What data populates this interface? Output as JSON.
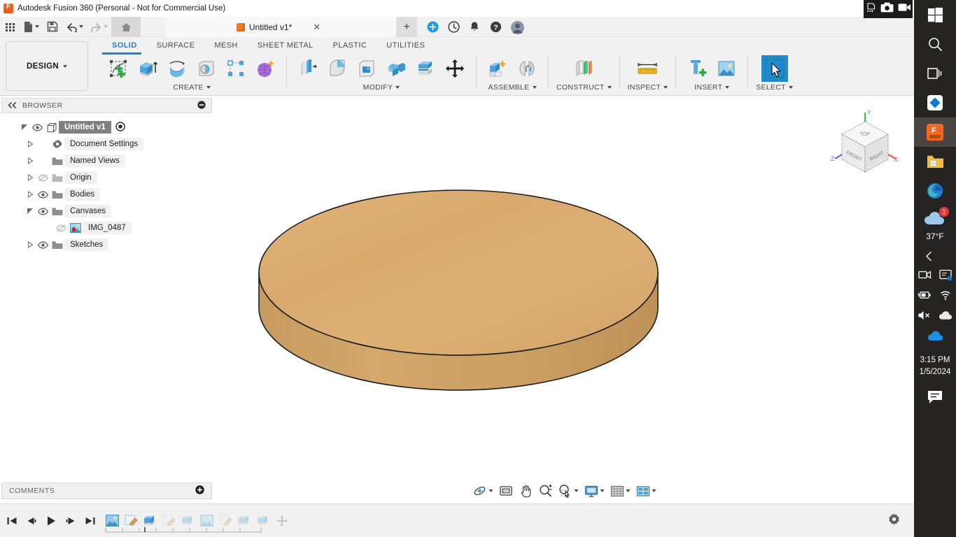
{
  "window": {
    "title": "Autodesk Fusion 360 (Personal - Not for Commercial Use)",
    "app_icon": "fusion-logo-icon",
    "controls": {
      "minimize": "—",
      "restore": "❐"
    }
  },
  "quick_access": {
    "items": [
      {
        "name": "app-grid-button",
        "icon": "grid-icon"
      },
      {
        "name": "new-file-button",
        "icon": "file-icon",
        "has_caret": true
      },
      {
        "name": "save-button",
        "icon": "floppy-disk-icon"
      },
      {
        "name": "undo-button",
        "icon": "undo-arrow-icon",
        "has_caret": true
      },
      {
        "name": "redo-button",
        "icon": "redo-arrow-icon",
        "has_caret": true
      },
      {
        "name": "home-button",
        "icon": "home-icon"
      }
    ]
  },
  "document_tab": {
    "label": "Untitled v1*",
    "icon": "orange-cube-icon",
    "close_label": "✕",
    "new_tab_label": "+",
    "icons": [
      {
        "name": "extension-manager-icon"
      },
      {
        "name": "job-status-icon"
      },
      {
        "name": "notifications-bell-icon"
      },
      {
        "name": "help-question-icon"
      },
      {
        "name": "user-avatar-icon"
      }
    ]
  },
  "ribbon": {
    "workspace_label": "DESIGN",
    "tabs": [
      {
        "label": "SOLID",
        "active": true
      },
      {
        "label": "SURFACE",
        "active": false
      },
      {
        "label": "MESH",
        "active": false
      },
      {
        "label": "SHEET METAL",
        "active": false
      },
      {
        "label": "PLASTIC",
        "active": false
      },
      {
        "label": "UTILITIES",
        "active": false
      }
    ],
    "panels": [
      {
        "label": "CREATE",
        "has_caret": true,
        "tools": [
          {
            "name": "create-sketch-tool",
            "icon": "sketch-plus-icon"
          },
          {
            "name": "extrude-tool",
            "icon": "extrude-icon"
          },
          {
            "name": "revolve-tool",
            "icon": "revolve-icon"
          },
          {
            "name": "hole-tool",
            "icon": "hole-icon"
          },
          {
            "name": "rectangular-pattern-tool",
            "icon": "pattern-icon"
          },
          {
            "name": "form-tool",
            "icon": "form-sphere-icon"
          }
        ]
      },
      {
        "label": "MODIFY",
        "has_caret": true,
        "tools": [
          {
            "name": "press-pull-tool",
            "icon": "press-pull-icon"
          },
          {
            "name": "fillet-tool",
            "icon": "fillet-icon"
          },
          {
            "name": "shell-tool",
            "icon": "shell-icon"
          },
          {
            "name": "combine-tool",
            "icon": "combine-icon"
          },
          {
            "name": "split-face-tool",
            "icon": "split-face-icon"
          },
          {
            "name": "move-copy-tool",
            "icon": "move-arrows-icon"
          }
        ]
      },
      {
        "label": "ASSEMBLE",
        "has_caret": true,
        "tools": [
          {
            "name": "new-component-tool",
            "icon": "new-component-icon"
          },
          {
            "name": "joint-tool",
            "icon": "joint-icon"
          }
        ]
      },
      {
        "label": "CONSTRUCT",
        "has_caret": true,
        "tools": [
          {
            "name": "construction-plane-tool",
            "icon": "offset-plane-icon"
          }
        ]
      },
      {
        "label": "INSPECT",
        "has_caret": true,
        "tools": [
          {
            "name": "measure-tool",
            "icon": "ruler-measure-icon"
          }
        ]
      },
      {
        "label": "INSERT",
        "has_caret": true,
        "tools": [
          {
            "name": "insert-mcmaster-tool",
            "icon": "bolt-plus-icon"
          },
          {
            "name": "insert-canvas-tool",
            "icon": "picture-icon"
          }
        ]
      },
      {
        "label": "SELECT",
        "has_caret": true,
        "tools": [
          {
            "name": "select-tool",
            "icon": "select-cursor-icon",
            "selected": true
          }
        ]
      }
    ]
  },
  "browser": {
    "header_title": "BROWSER",
    "collapse_icon": "collapse-left-icon",
    "minus_icon": "minus-circle-icon",
    "tree": [
      {
        "label": "Untitled v1",
        "indent": 0,
        "arrow": "expanded",
        "eye": "visible",
        "icon": "component-cube-icon",
        "root": true,
        "radio": true
      },
      {
        "label": "Document Settings",
        "indent": 1,
        "arrow": "collapsed",
        "eye": "none",
        "icon": "gear-icon"
      },
      {
        "label": "Named Views",
        "indent": 1,
        "arrow": "collapsed",
        "eye": "none",
        "icon": "folder-icon"
      },
      {
        "label": "Origin",
        "indent": 1,
        "arrow": "collapsed",
        "eye": "hidden",
        "icon": "folder-icon"
      },
      {
        "label": "Bodies",
        "indent": 1,
        "arrow": "collapsed",
        "eye": "visible",
        "icon": "folder-icon"
      },
      {
        "label": "Canvases",
        "indent": 1,
        "arrow": "expanded",
        "eye": "visible",
        "icon": "folder-icon"
      },
      {
        "label": "IMG_0487",
        "indent": 2,
        "arrow": "none",
        "eye": "hidden",
        "icon": "canvas-image-icon"
      },
      {
        "label": "Sketches",
        "indent": 1,
        "arrow": "collapsed",
        "eye": "visible",
        "icon": "folder-icon"
      }
    ],
    "comments": {
      "title": "COMMENTS",
      "add_icon": "plus-circle-icon"
    }
  },
  "viewcube": {
    "faces": {
      "top": "TOP",
      "front": "FRONT",
      "right": "RIGHT"
    },
    "axes": [
      {
        "label": "Y",
        "color": "#33c24d"
      },
      {
        "label": "X",
        "color": "#ef5350"
      },
      {
        "label": "Z",
        "color": "#5577dd"
      }
    ]
  },
  "model": {
    "name": "wood-cylinder-body",
    "top_color": "#dcae71",
    "side_color": "#cb9e62",
    "edge_color": "#1a1a1a"
  },
  "nav_toolbar": {
    "items": [
      {
        "name": "orbit-button",
        "icon": "orbit-icon",
        "has_caret": true
      },
      {
        "name": "look-at-button",
        "icon": "look-at-icon",
        "has_caret": false
      },
      {
        "name": "pan-button",
        "icon": "hand-pan-icon",
        "has_caret": false
      },
      {
        "name": "zoom-button",
        "icon": "zoom-plusminus-icon",
        "has_caret": false
      },
      {
        "name": "zoom-window-button",
        "icon": "zoom-window-icon",
        "has_caret": true
      },
      {
        "name": "display-settings-button",
        "icon": "monitor-icon",
        "has_caret": true
      },
      {
        "name": "grid-snaps-button",
        "icon": "grid-snap-icon",
        "has_caret": true
      },
      {
        "name": "viewports-button",
        "icon": "viewports-icon",
        "has_caret": true
      }
    ]
  },
  "timeline": {
    "playback": [
      {
        "name": "go-to-beginning-button",
        "icon": "skip-start-icon"
      },
      {
        "name": "step-back-button",
        "icon": "step-back-icon"
      },
      {
        "name": "play-button",
        "icon": "play-icon"
      },
      {
        "name": "step-forward-button",
        "icon": "step-forward-icon"
      },
      {
        "name": "go-to-end-button",
        "icon": "skip-end-icon"
      }
    ],
    "features": [
      {
        "name": "timeline-feature-canvas",
        "icon": "canvas-image-icon",
        "state": "active"
      },
      {
        "name": "timeline-feature-sketch-1",
        "icon": "sketch-edit-icon",
        "state": "active"
      },
      {
        "name": "timeline-feature-extrude-1",
        "icon": "extrude-icon",
        "state": "active"
      },
      {
        "name": "timeline-feature-sketch-2",
        "icon": "sketch-edit-icon",
        "state": "rolled-back"
      },
      {
        "name": "timeline-feature-extrude-2",
        "icon": "extrude-icon",
        "state": "rolled-back"
      },
      {
        "name": "timeline-feature-canvas-2",
        "icon": "canvas-image-icon",
        "state": "rolled-back"
      },
      {
        "name": "timeline-feature-sketch-3",
        "icon": "sketch-edit-icon",
        "state": "rolled-back"
      },
      {
        "name": "timeline-feature-extrude-3",
        "icon": "extrude-icon",
        "state": "rolled-back"
      },
      {
        "name": "timeline-feature-extrude-4",
        "icon": "extrude-icon",
        "state": "rolled-back"
      },
      {
        "name": "timeline-feature-move",
        "icon": "move-arrows-icon",
        "state": "rolled-back"
      }
    ],
    "settings_icon": "gear-icon"
  },
  "taskbar": {
    "apps": [
      {
        "name": "start-button",
        "icon": "windows-logo-icon"
      },
      {
        "name": "search-button",
        "icon": "search-icon"
      },
      {
        "name": "task-view-button",
        "icon": "task-view-icon"
      },
      {
        "name": "widgets-button",
        "icon": "diamond-blue-icon"
      },
      {
        "name": "fusion-taskbar-button",
        "icon": "fusion-logo-icon",
        "active": true
      },
      {
        "name": "file-explorer-button",
        "icon": "folder-explorer-icon"
      },
      {
        "name": "edge-button",
        "icon": "edge-browser-icon"
      }
    ],
    "tray": {
      "weather_temp": "37°F",
      "weather_icon": "cloud-icon",
      "weather_badge": "1",
      "expand_icon": "chevron-left-icon",
      "icons": [
        {
          "name": "camera-tray-icon",
          "icon": "camera-icon"
        },
        {
          "name": "display-tray-icon",
          "icon": "display-icon"
        },
        {
          "name": "battery-tray-icon",
          "icon": "battery-charging-icon"
        },
        {
          "name": "wifi-tray-icon",
          "icon": "wifi-icon"
        },
        {
          "name": "volume-tray-icon",
          "icon": "speaker-muted-icon"
        },
        {
          "name": "onedrive-tray-icon",
          "icon": "cloud-white-icon"
        }
      ],
      "onedrive_icon": "onedrive-blue-icon",
      "time": "3:15 PM",
      "date": "1/5/2024",
      "action_center_icon": "chat-bubble-icon"
    }
  },
  "recorder": {
    "screenshot_icon": "camera-icon",
    "record_icon": "video-camera-icon",
    "more_icon": "more-dots-icon"
  }
}
